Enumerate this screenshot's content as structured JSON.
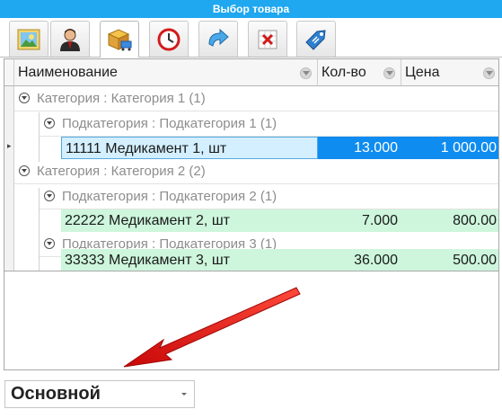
{
  "window": {
    "title": "Выбор товара"
  },
  "toolbar": {
    "tabs": [
      {
        "icon": "picture-icon"
      },
      {
        "icon": "user-icon"
      },
      {
        "icon": "box-cart-icon"
      },
      {
        "icon": "clock-icon"
      },
      {
        "icon": "redo-arrow-icon"
      },
      {
        "icon": "excel-delete-icon"
      },
      {
        "icon": "price-tag-icon"
      }
    ],
    "active_tab": 2
  },
  "grid": {
    "columns": [
      "Наименование",
      "Кол-во",
      "Цена"
    ],
    "groups": [
      {
        "category": "Категория : Категория 1 (1)",
        "subgroups": [
          {
            "subcategory": "Подкатегория : Подкатегория 1 (1)",
            "rows": [
              {
                "name": "11111 Медикамент 1, шт",
                "qty": "13.000",
                "price": "1 000.00",
                "selected": true
              }
            ]
          }
        ]
      },
      {
        "category": "Категория : Категория 2 (2)",
        "subgroups": [
          {
            "subcategory": "Подкатегория : Подкатегория 2 (1)",
            "rows": [
              {
                "name": "22222 Медикамент 2, шт",
                "qty": "7.000",
                "price": "800.00"
              }
            ]
          },
          {
            "subcategory": "Подкатегория : Подкатегория 3 (1)",
            "rows": [
              {
                "name": "33333 Медикамент 3, шт",
                "qty": "36.000",
                "price": "500.00"
              }
            ]
          }
        ]
      }
    ]
  },
  "selector": {
    "value": "Основной"
  },
  "colors": {
    "titlebar": "#1fa7ef",
    "selected_row": "#0f8cf0",
    "selected_name": "#d4efff",
    "row_highlight": "#cdf6dc",
    "annotation_arrow": "#e01010"
  }
}
